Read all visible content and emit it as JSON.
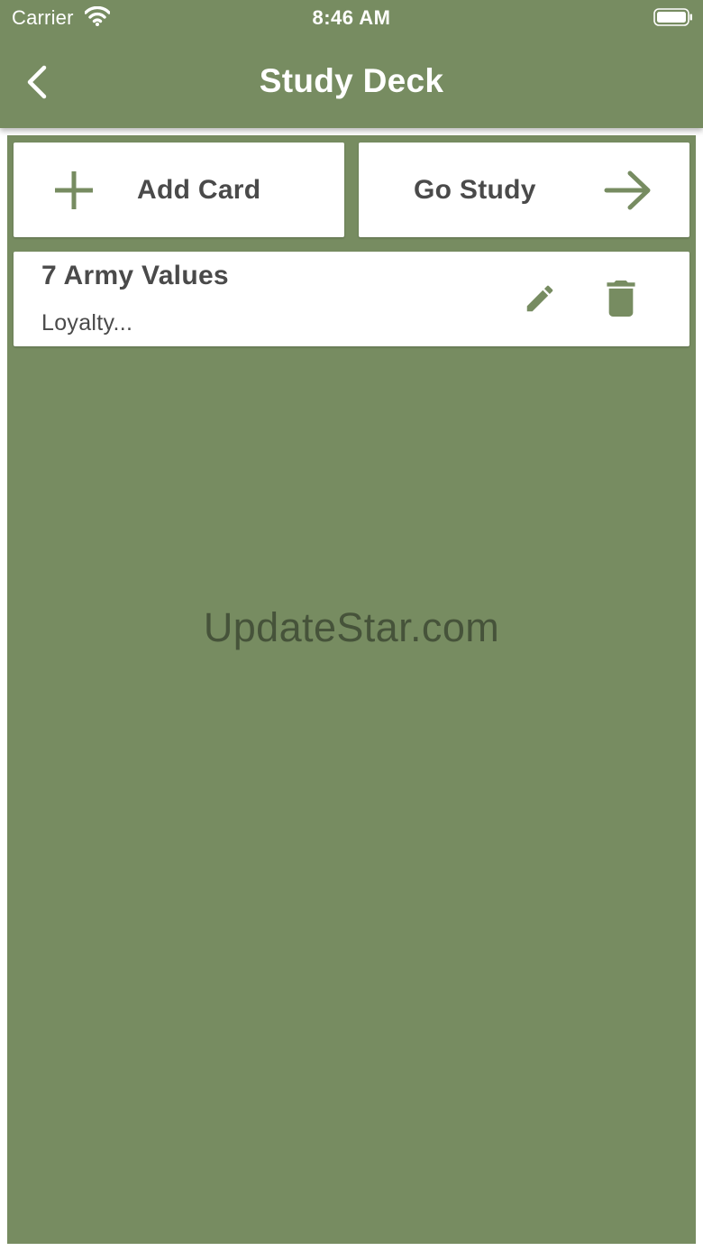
{
  "status_bar": {
    "carrier": "Carrier",
    "time": "8:46 AM",
    "wifi_icon": "wifi-icon",
    "battery_icon": "battery-icon"
  },
  "nav": {
    "title": "Study Deck",
    "back_icon": "chevron-left-icon"
  },
  "actions": {
    "add_card_label": "Add Card",
    "add_card_icon": "plus-icon",
    "go_study_label": "Go Study",
    "go_study_icon": "arrow-right-icon"
  },
  "cards": [
    {
      "title": "7 Army Values",
      "preview": "Loyalty...",
      "edit_icon": "pencil-icon",
      "delete_icon": "trash-icon"
    }
  ],
  "watermark": "UpdateStar.com",
  "colors": {
    "primary": "#778c61",
    "surface": "#ffffff",
    "text": "#4a4a4a"
  }
}
